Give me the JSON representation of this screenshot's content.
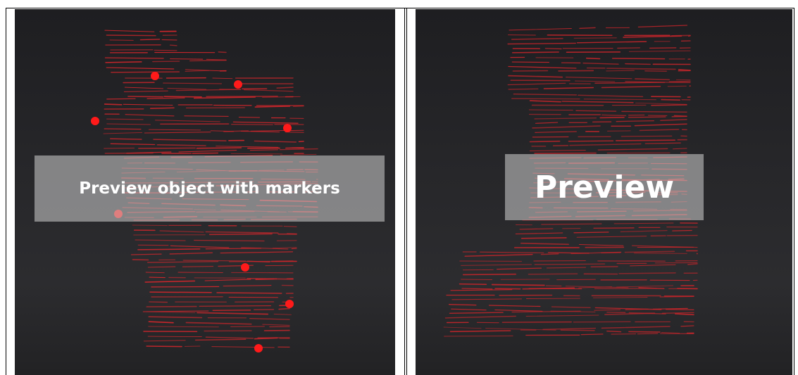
{
  "left_panel": {
    "caption": "Preview object with markers",
    "stripe_color": "#d6262b",
    "marker_color": "#ff1a1a"
  },
  "right_panel": {
    "caption": "Preview",
    "stripe_color": "#c8252a"
  },
  "background_color": "#272729"
}
